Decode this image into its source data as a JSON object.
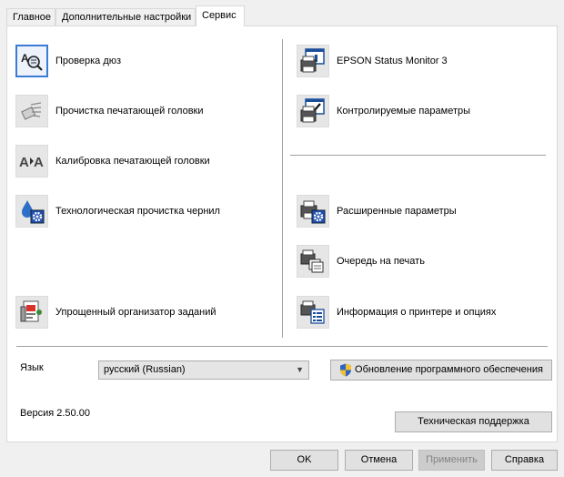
{
  "tabs": [
    {
      "label": "Главное"
    },
    {
      "label": "Дополнительные настройки"
    },
    {
      "label": "Сервис"
    }
  ],
  "tools_left": [
    {
      "label": "Проверка дюз",
      "icon": "nozzle-check-icon"
    },
    {
      "label": "Прочистка печатающей головки",
      "icon": "head-cleaning-icon"
    },
    {
      "label": "Калибровка печатающей головки",
      "icon": "head-alignment-icon"
    },
    {
      "label": "Технологическая прочистка чернил",
      "icon": "ink-flush-icon"
    },
    {
      "label": "Упрощенный организатор заданий",
      "icon": "job-arranger-icon"
    }
  ],
  "tools_right": [
    {
      "label": "EPSON Status Monitor 3",
      "icon": "status-monitor-icon"
    },
    {
      "label": "Контролируемые параметры",
      "icon": "monitoring-preferences-icon"
    },
    {
      "label": "Расширенные параметры",
      "icon": "extended-settings-icon"
    },
    {
      "label": "Очередь на печать",
      "icon": "print-queue-icon"
    },
    {
      "label": "Информация о принтере и опциях",
      "icon": "printer-info-icon"
    }
  ],
  "language": {
    "label": "Язык",
    "value": "русский (Russian)"
  },
  "update_button": {
    "label": "Обновление программного обеспечения",
    "icon": "shield-icon"
  },
  "version": "Версия 2.50.00",
  "support_button": "Техническая поддержка",
  "dialog_buttons": {
    "ok": "OK",
    "cancel": "Отмена",
    "apply": "Применить",
    "help": "Справка"
  },
  "colors": {
    "focus": "#3a7bd5",
    "panel": "#ffffff",
    "background": "#f0f0f0"
  }
}
